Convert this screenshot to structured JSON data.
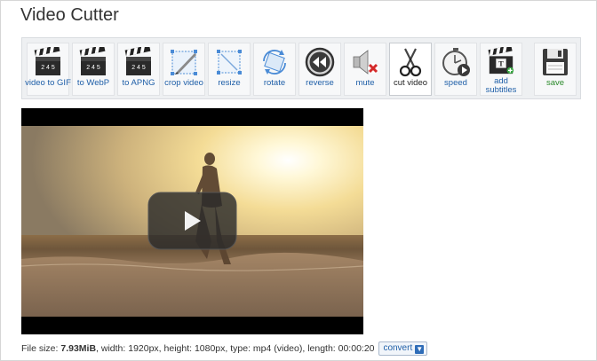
{
  "page": {
    "title": "Video Cutter"
  },
  "toolbar": {
    "items": [
      {
        "label": "video to GIF",
        "icon": "clapperboard-icon"
      },
      {
        "label": "to WebP",
        "icon": "clapperboard-icon"
      },
      {
        "label": "to APNG",
        "icon": "clapperboard-icon"
      },
      {
        "label": "crop video",
        "icon": "crop-icon"
      },
      {
        "label": "resize",
        "icon": "resize-icon"
      },
      {
        "label": "rotate",
        "icon": "rotate-icon"
      },
      {
        "label": "reverse",
        "icon": "rewind-icon"
      },
      {
        "label": "mute",
        "icon": "mute-icon"
      },
      {
        "label": "cut video",
        "icon": "scissors-icon",
        "active": true
      },
      {
        "label": "speed",
        "icon": "stopwatch-icon"
      },
      {
        "label": "add subtitles",
        "icon": "subtitles-icon"
      },
      {
        "label": "save",
        "icon": "floppy-disk-icon"
      }
    ],
    "clapper_numbers": "2 4 5"
  },
  "info": {
    "file_size_label": "File size:",
    "file_size": "7.93MiB",
    "details": ", width: 1920px, height: 1080px, type: mp4 (video), length: 00:00:20",
    "convert_label": "convert"
  },
  "colors": {
    "link": "#1f5fa8",
    "save": "#2b8a2b",
    "toolbar_bg": "#eef0f2"
  }
}
